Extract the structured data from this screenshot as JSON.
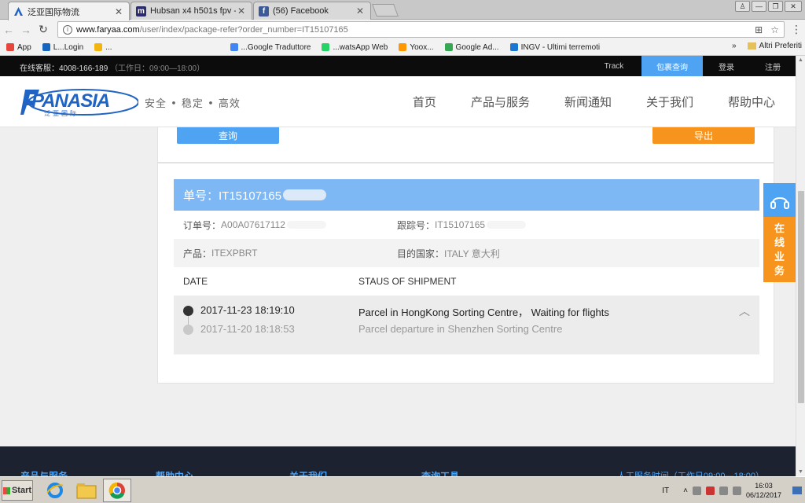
{
  "browser": {
    "tabs": [
      {
        "title": "泛亚国际物流",
        "favicon": "panasia-icon",
        "favicon_color": "#1f64c4"
      },
      {
        "title": "Hubsan x4 h501s fpv - Pagi",
        "favicon": "hubsan-icon",
        "favicon_color": "#2b2b6e"
      },
      {
        "title": "(56) Facebook",
        "favicon": "facebook-icon",
        "favicon_color": "#3b5998"
      }
    ],
    "url_host": "www.faryaa.com",
    "url_path": "/user/index/package-refer?order_number=IT15107165",
    "bookmarks": [
      {
        "label": "App",
        "color": "#e8453c"
      },
      {
        "label": "L...Login",
        "color": "#1565c0"
      },
      {
        "label": "...",
        "color": "#f2b50f"
      },
      {
        "label": "...Google Traduttore",
        "color": "#4285f4"
      },
      {
        "label": "...watsApp Web",
        "color": "#25d366"
      },
      {
        "label": "Yoox...",
        "color": "#ff9800"
      },
      {
        "label": "Google Ad...",
        "color": "#34a853"
      },
      {
        "label": "INGV - Ultimi terremoti",
        "color": "#1976d2"
      }
    ],
    "bookmarks_more": "»",
    "other_bookmarks": "Altri Preferiti",
    "window_controls": [
      "user-icon",
      "minimize-icon",
      "maximize-icon",
      "close-icon"
    ]
  },
  "site": {
    "hotline_label": "在线客服：4008-166-189",
    "hotline_hours": "（工作日：09:00—18:00）",
    "top_links": [
      {
        "label": "Track",
        "active": false
      },
      {
        "label": "包裹查询",
        "active": true
      },
      {
        "label": "登录",
        "active": false
      },
      {
        "label": "注册",
        "active": false
      }
    ],
    "logo_text": "PANASIA",
    "logo_sub": "泛亚国际",
    "slogan": "安全 • 稳定 • 高效",
    "nav": [
      "首页",
      "产品与服务",
      "新闻通知",
      "关于我们",
      "帮助中心"
    ],
    "query_button": "查询",
    "export_button": "导出",
    "result": {
      "tracking_header": "单号：IT15107165",
      "order_no_label": "订单号：",
      "order_no_value": "A00A07617112",
      "track_no_label": "跟踪号：",
      "track_no_value": "IT15107165",
      "product_label": "产品：",
      "product_value": "ITEXPBRT",
      "dest_label": "目的国家：",
      "dest_value": "ITALY 意大利",
      "col_date": "DATE",
      "col_status": "STAUS OF SHIPMENT",
      "events": [
        {
          "date": "2017-11-23 18:19:10",
          "status": "Parcel in HongKong Sorting Centre， Waiting for flights",
          "current": true
        },
        {
          "date": "2017-11-20 18:18:53",
          "status": "Parcel departure in Shenzhen Sorting Centre",
          "current": false
        }
      ]
    },
    "float_online": [
      "在",
      "线",
      "业",
      "务"
    ],
    "footer_headings": [
      "产品与服务",
      "帮助中心",
      "关于我们",
      "查询工具"
    ],
    "footer_service": "人工服务时间（工作日09:00—18:00）",
    "colors": {
      "blue": "#4ea3f2",
      "orange": "#f7941d",
      "header_blue": "#7db8f5",
      "logo_blue": "#1f64c4"
    }
  },
  "taskbar": {
    "start_label": "Start",
    "apps": [
      "ie-icon",
      "explorer-icon",
      "chrome-icon"
    ],
    "lang": "IT",
    "time": "16:03",
    "date": "06/12/2017"
  }
}
